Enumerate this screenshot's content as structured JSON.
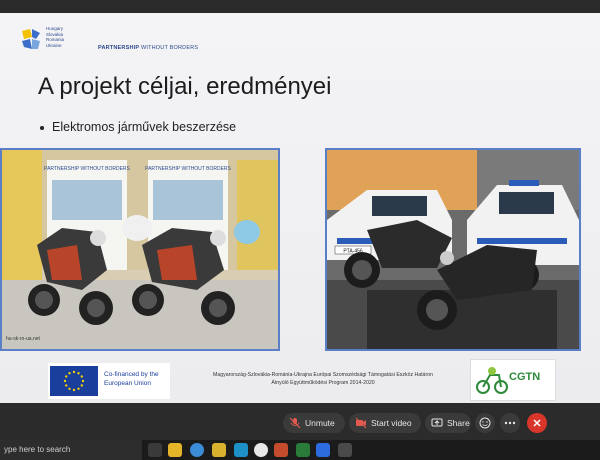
{
  "slide": {
    "logo_lines": [
      "Hungary",
      "Slovakia",
      "Romania",
      "Ukraine"
    ],
    "partnership_bold": "PARTNERSHIP",
    "partnership_rest": " WITHOUT BORDERS",
    "title": "A projekt céljai, eredményei",
    "bullet": "Elektromos járművek beszerzése",
    "photo_left_banner": "PARTNERSHIP WITHOUT BORDERS",
    "photo_left_site": "hu-sk-ro-ua.net",
    "photo_right_plate": "PTA-456",
    "eu_text_line1": "Co-financed by the",
    "eu_text_line2": "European Union",
    "program_line1": "Magyarország-Szlovákia-Románia-Ukrajna Európai Szomszédsági Támogatási Eszköz Határon",
    "program_line2": "Átnyúló Együttműködési Program 2014-2020",
    "cgtn_label": "CGTN"
  },
  "meeting": {
    "unmute_label": "Unmute",
    "video_label": "Start video",
    "share_label": "Share"
  },
  "taskbar": {
    "search_placeholder": "ype here to search"
  },
  "colors": {
    "accent_blue": "#2b4a8c",
    "leave_red": "#d8362b",
    "eu_blue": "#1a3e9c",
    "cgtn_green": "#2d8a3a"
  }
}
